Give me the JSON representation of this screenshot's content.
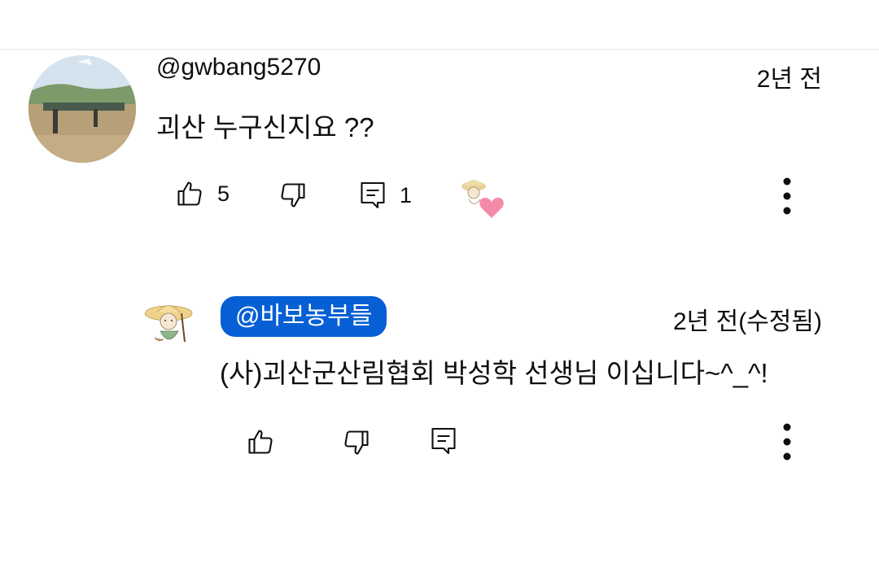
{
  "comments": [
    {
      "author": "@gwbang5270",
      "time": "2년 전",
      "text": "괴산 누구신지요 ??",
      "like_count": "5",
      "reply_count": "1",
      "icons": {
        "like": "thumb-up-icon",
        "dislike": "thumb-down-icon",
        "reply": "comment-icon",
        "creator_heart": "creator-heart-icon",
        "more": "more-vert-icon"
      }
    }
  ],
  "reply": {
    "author": "@바보농부들",
    "time": "2년 전(수정됨)",
    "text": "(사)괴산군산림협회 박성학 선생님 이십니다~^_^!",
    "author_badge_color": "#065fd4"
  },
  "colors": {
    "text": "#0f0f0f",
    "divider": "#e5e5e5",
    "heart": "#f38ba8"
  }
}
